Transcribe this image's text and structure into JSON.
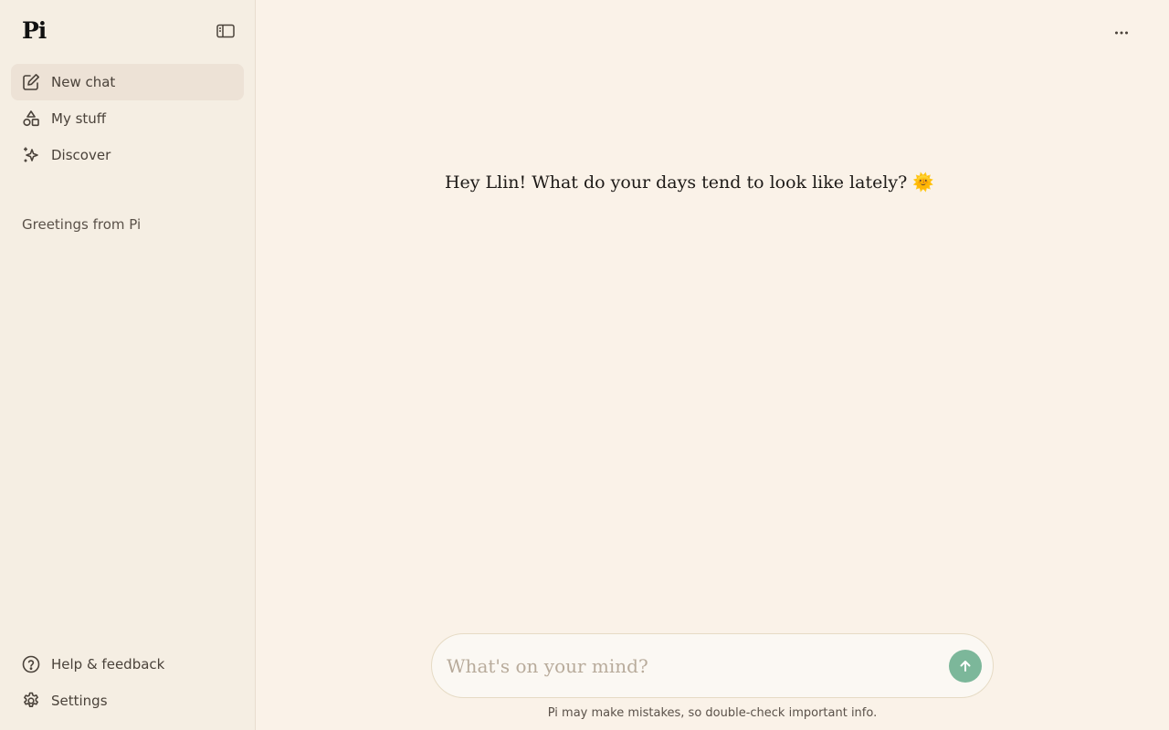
{
  "app": {
    "logo": "Pi"
  },
  "sidebar": {
    "nav": [
      {
        "label": "New chat",
        "icon": "edit-icon",
        "active": true
      },
      {
        "label": "My stuff",
        "icon": "shapes-icon",
        "active": false
      },
      {
        "label": "Discover",
        "icon": "sparkles-icon",
        "active": false
      }
    ],
    "section_title": "Greetings from Pi",
    "bottom": [
      {
        "label": "Help & feedback",
        "icon": "help-circle-icon"
      },
      {
        "label": "Settings",
        "icon": "gear-icon"
      }
    ]
  },
  "main": {
    "greeting": "Hey Llin! What do your days tend to look like lately?",
    "greeting_emoji": "🌞",
    "composer": {
      "placeholder": "What's on your mind?",
      "value": ""
    },
    "disclaimer": "Pi may make mistakes, so double-check important info."
  },
  "colors": {
    "background": "#faf2e8",
    "sidebar_background": "#f5eee3",
    "active_item": "#ede2d6",
    "send_button": "#7cb79a"
  }
}
